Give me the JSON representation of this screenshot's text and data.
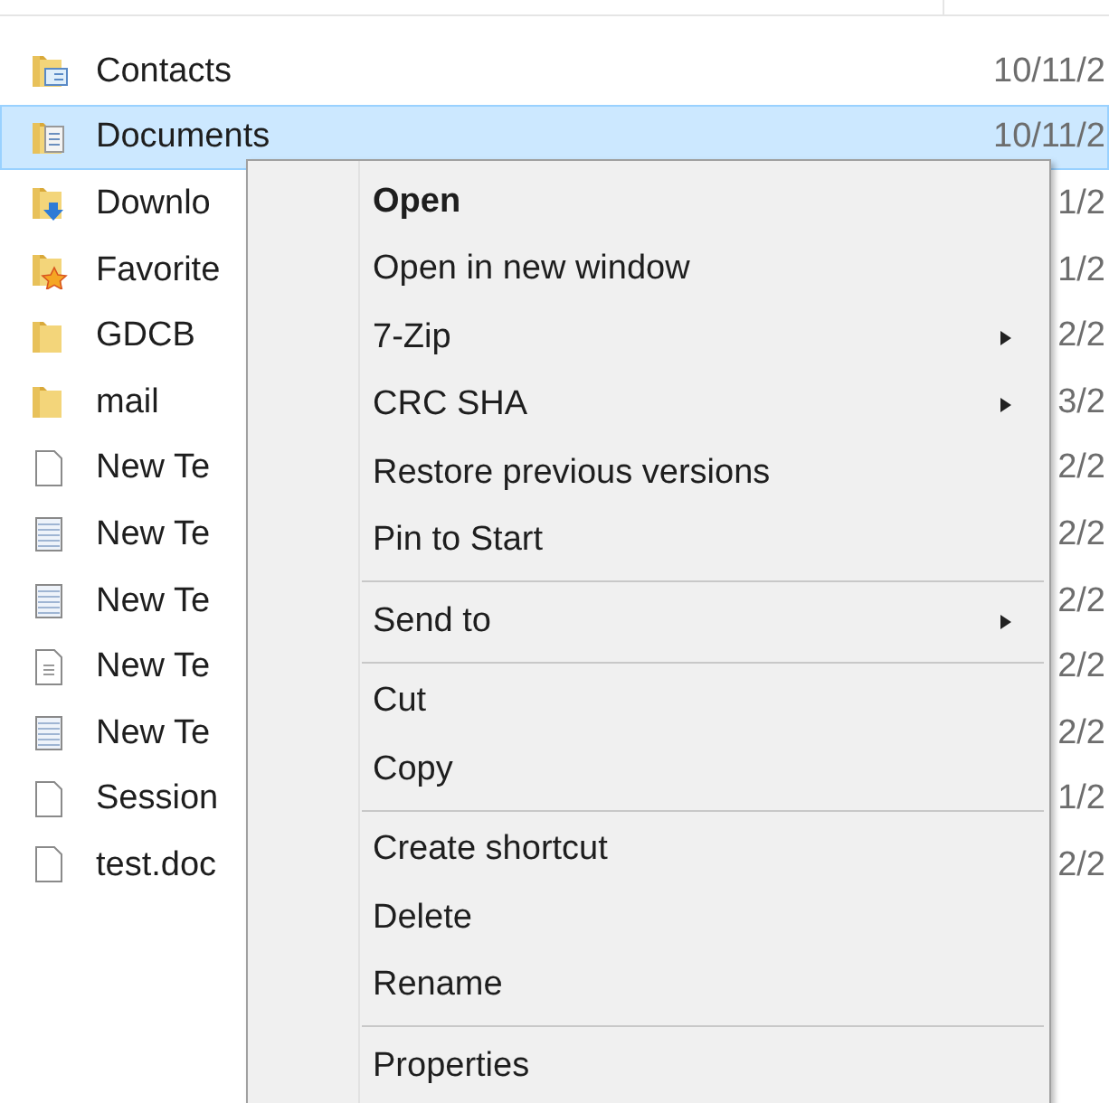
{
  "files": [
    {
      "name": "Contacts",
      "kind": "contacts",
      "date": "10/11/2",
      "selected": false
    },
    {
      "name": "Documents",
      "kind": "documents",
      "date": "10/11/2",
      "selected": true
    },
    {
      "name": "Downlo",
      "kind": "downloads",
      "date": "1/2",
      "selected": false
    },
    {
      "name": "Favorite",
      "kind": "favorites",
      "date": "1/2",
      "selected": false
    },
    {
      "name": "GDCB",
      "kind": "folder",
      "date": "2/2",
      "selected": false
    },
    {
      "name": "mail",
      "kind": "folder",
      "date": "3/2",
      "selected": false
    },
    {
      "name": "New Te",
      "kind": "file",
      "date": "2/2",
      "selected": false
    },
    {
      "name": "New Te",
      "kind": "notepad",
      "date": "2/2",
      "selected": false
    },
    {
      "name": "New Te",
      "kind": "notepad",
      "date": "2/2",
      "selected": false
    },
    {
      "name": "New Te",
      "kind": "text",
      "date": "2/2",
      "selected": false
    },
    {
      "name": "New Te",
      "kind": "notepad",
      "date": "2/2",
      "selected": false
    },
    {
      "name": "Session",
      "kind": "file",
      "date": "1/2",
      "selected": false
    },
    {
      "name": "test.doc",
      "kind": "file",
      "date": "2/2",
      "selected": false
    }
  ],
  "context_menu": [
    {
      "kind": "item",
      "label": "Open",
      "default": true,
      "submenu": false
    },
    {
      "kind": "item",
      "label": "Open in new window",
      "default": false,
      "submenu": false
    },
    {
      "kind": "item",
      "label": "7-Zip",
      "default": false,
      "submenu": true
    },
    {
      "kind": "item",
      "label": "CRC SHA",
      "default": false,
      "submenu": true
    },
    {
      "kind": "item",
      "label": "Restore previous versions",
      "default": false,
      "submenu": false
    },
    {
      "kind": "item",
      "label": "Pin to Start",
      "default": false,
      "submenu": false
    },
    {
      "kind": "separator"
    },
    {
      "kind": "item",
      "label": "Send to",
      "default": false,
      "submenu": true
    },
    {
      "kind": "separator"
    },
    {
      "kind": "item",
      "label": "Cut",
      "default": false,
      "submenu": false
    },
    {
      "kind": "item",
      "label": "Copy",
      "default": false,
      "submenu": false
    },
    {
      "kind": "separator"
    },
    {
      "kind": "item",
      "label": "Create shortcut",
      "default": false,
      "submenu": false
    },
    {
      "kind": "item",
      "label": "Delete",
      "default": false,
      "submenu": false
    },
    {
      "kind": "item",
      "label": "Rename",
      "default": false,
      "submenu": false
    },
    {
      "kind": "separator"
    },
    {
      "kind": "item",
      "label": "Properties",
      "default": false,
      "submenu": false
    }
  ]
}
